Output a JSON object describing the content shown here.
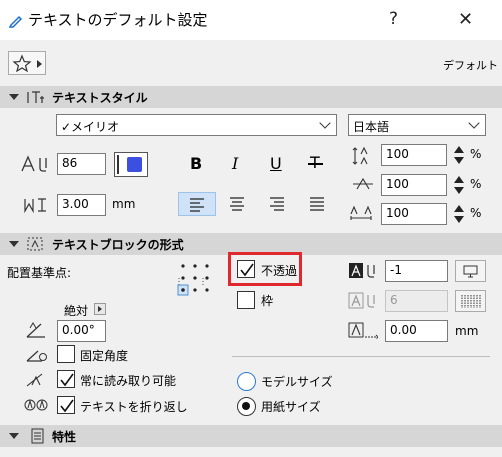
{
  "window": {
    "title": "テキストのデフォルト設定",
    "help": "?",
    "close": "✕"
  },
  "toolbar": {
    "favorites_label": "デフォルト"
  },
  "text_style": {
    "section_title": "テキストスタイル",
    "font_value": "✓メイリオ",
    "language_value": "日本語",
    "size_value": "86",
    "width_value": "3.00",
    "width_unit": "mm",
    "line_spacing_value": "100",
    "char_width_value": "100",
    "char_spacing_value": "100",
    "percent": "%",
    "bold": "B",
    "italic": "I",
    "underline": "U",
    "strike": "T",
    "pen_color": "#3b4fe0"
  },
  "text_block": {
    "section_title": "テキストブロックの形式",
    "anchor_label": "配置基準点:",
    "opaque_label": "不透過",
    "frame_label": "枠",
    "angle_mode_label": "絶対",
    "angle_value": "0.00°",
    "fixed_angle_label": "固定角度",
    "always_readable_label": "常に読み取り可能",
    "wrap_label": "テキストを折り返し",
    "model_size_label": "モデルサイズ",
    "paper_size_label": "用紙サイズ",
    "bg_pen_value": "-1",
    "frame_pen_value": "6",
    "frame_offset_value": "0.00",
    "frame_offset_unit": "mm",
    "highlight_color": "#e0282f"
  },
  "properties": {
    "section_title": "特性"
  }
}
